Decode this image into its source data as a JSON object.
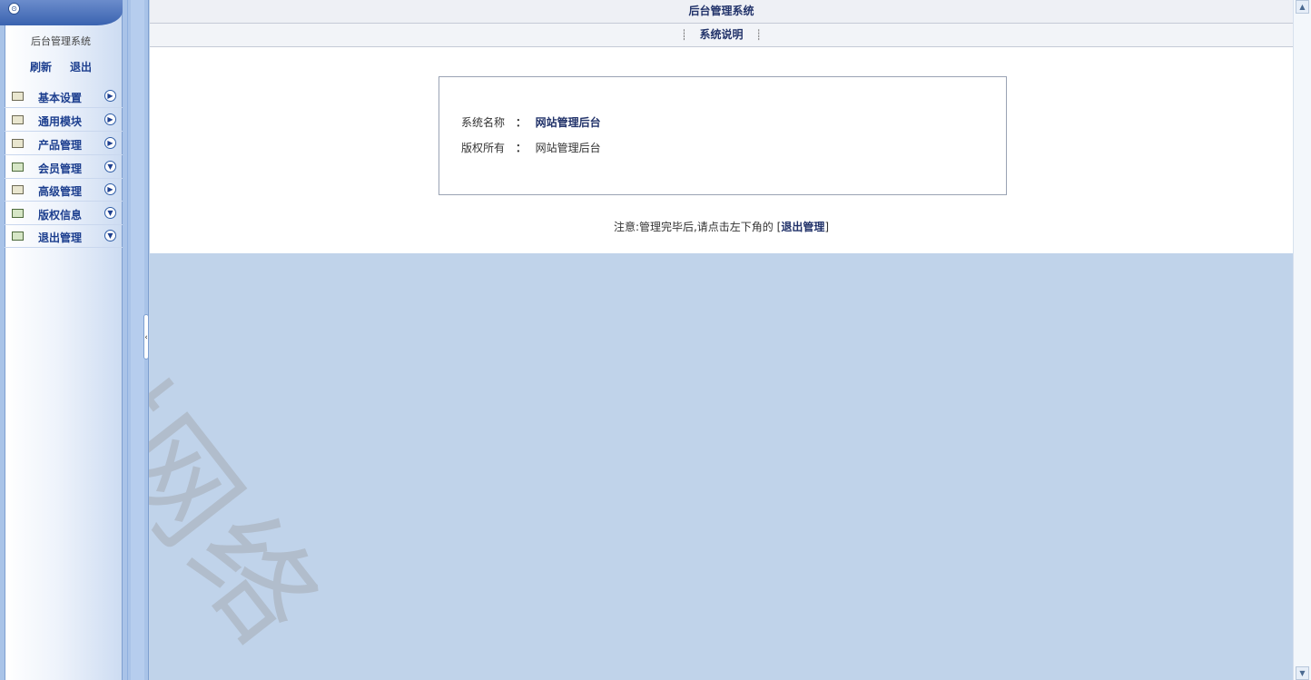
{
  "sidebar": {
    "site_title": "后台管理系统",
    "refresh_label": "刷新",
    "logout_label": "退出",
    "items": [
      {
        "label": "基本设置",
        "icon": "folder-icon",
        "arrow": "▶"
      },
      {
        "label": "通用模块",
        "icon": "folder-icon",
        "arrow": "▶"
      },
      {
        "label": "产品管理",
        "icon": "folder-icon",
        "arrow": "▶"
      },
      {
        "label": "会员管理",
        "icon": "edit-icon",
        "arrow": "▼"
      },
      {
        "label": "高级管理",
        "icon": "folder-icon",
        "arrow": "▶"
      },
      {
        "label": "版权信息",
        "icon": "edit-icon",
        "arrow": "▼"
      },
      {
        "label": "退出管理",
        "icon": "edit-icon",
        "arrow": "▼"
      }
    ]
  },
  "header": {
    "title": "后台管理系统",
    "tab": "系统说明"
  },
  "info": {
    "name_key": "系统名称",
    "name_colon": "：",
    "name_value": "网站管理后台",
    "copyright_key": "版权所有",
    "copyright_colon": "：",
    "copyright_value": "网站管理后台"
  },
  "note": {
    "prefix": "注意:管理完毕后,请点击左下角的",
    "open_bracket": "[",
    "link": "退出管理",
    "close_bracket": "]"
  },
  "watermark": "榕树网络",
  "colors": {
    "background": "#c0d3ea",
    "nav_text": "#1d3f8f",
    "header_text": "#22336a"
  }
}
